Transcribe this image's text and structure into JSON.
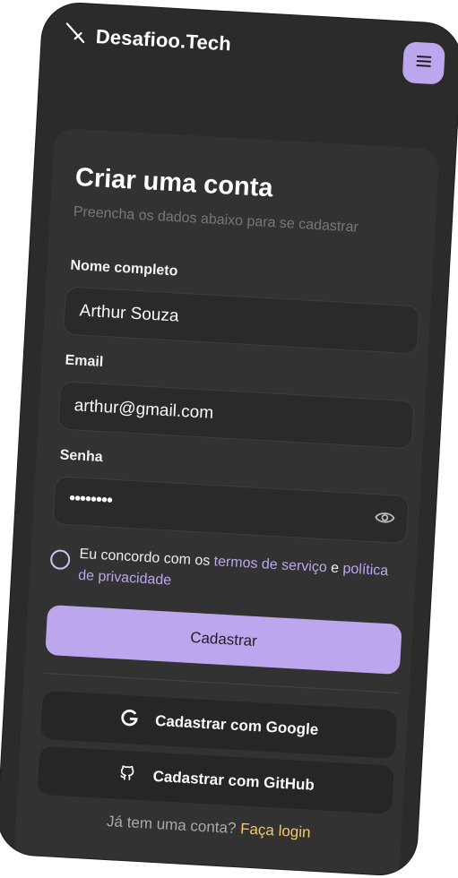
{
  "brand": {
    "name": "Desafioo.Tech"
  },
  "form": {
    "title": "Criar uma conta",
    "subtitle": "Preencha os dados abaixo para se cadastrar",
    "name_label": "Nome completo",
    "name_value": "Arthur Souza",
    "email_label": "Email",
    "email_value": "arthur@gmail.com",
    "password_label": "Senha",
    "password_masked": "••••••••",
    "terms_prefix": "Eu concordo com os",
    "terms_link": "termos de serviço",
    "terms_and": "e",
    "privacy_link": "política de privacidade",
    "submit_label": "Cadastrar",
    "google_label": "Cadastrar com Google",
    "github_label": "Cadastrar com GitHub",
    "footer_text": "Já tem uma conta?",
    "login_link": "Faça login"
  },
  "icons": {
    "brand": "sword-icon",
    "menu": "hamburger-menu-icon",
    "password_toggle": "eye-icon",
    "google": "google-icon",
    "github": "github-icon"
  },
  "colors": {
    "accent": "#bca7ef",
    "login_link": "#f2c96b",
    "background": "#2b2b2b"
  }
}
